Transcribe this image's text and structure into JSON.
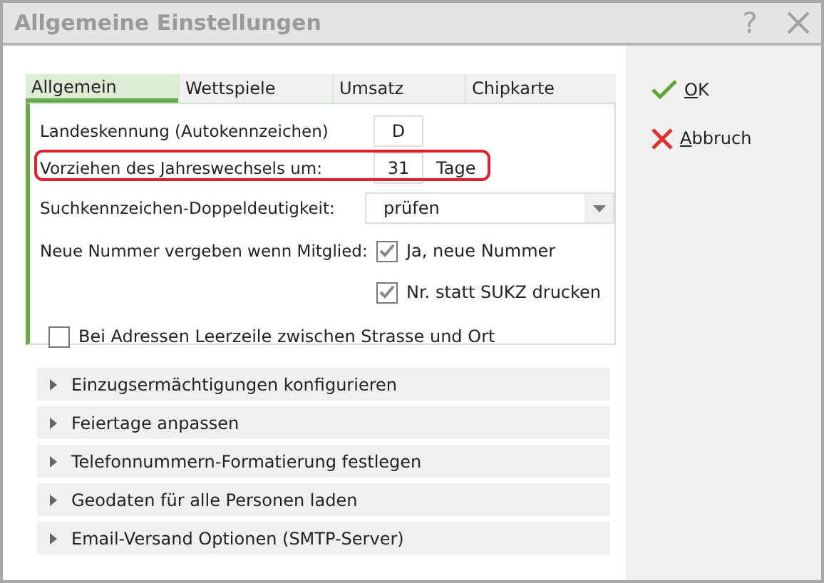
{
  "window": {
    "title": "Allgemeine Einstellungen",
    "help": "?"
  },
  "tabs": [
    {
      "label": "Allgemein",
      "selected": true
    },
    {
      "label": "Wettspiele",
      "selected": false
    },
    {
      "label": "Umsatz",
      "selected": false
    },
    {
      "label": "Chipkarte",
      "selected": false
    }
  ],
  "fields": [
    {
      "kind": "input",
      "label": "Landeskennung (Autokennzeichen)",
      "value": "D",
      "highlighted": false
    },
    {
      "kind": "input",
      "label": "Vorziehen des Jahreswechsels um:",
      "value": "31",
      "unit": "Tage",
      "highlighted": true
    },
    {
      "kind": "select",
      "label": "Suchkennzeichen-Doppeldeutigkeit:",
      "value": "prüfen",
      "highlighted": false
    },
    {
      "kind": "checks",
      "label": "Neue Nummer vergeben wenn Mitglied:",
      "options": [
        {
          "label": "Ja, neue Nummer",
          "checked": true
        },
        {
          "label": "Nr. statt SUKZ drucken",
          "checked": true
        }
      ],
      "highlighted": false
    }
  ],
  "address_check": {
    "label": "Bei Adressen Leerzeile zwischen Strasse und Ort",
    "checked": false
  },
  "sections": [
    {
      "label": "Einzugsermächtigungen konfigurieren",
      "expanded": false
    },
    {
      "label": "Feiertage anpassen",
      "expanded": false
    },
    {
      "label": "Telefonnummern-Formatierung festlegen",
      "expanded": false
    },
    {
      "label": "Geodaten für alle Personen laden",
      "expanded": false
    },
    {
      "label": "Email-Versand Optionen (SMTP-Server)",
      "expanded": false
    }
  ],
  "buttons": [
    {
      "kind": "ok",
      "label": "OK"
    },
    {
      "kind": "cancel",
      "label": "Abbruch"
    }
  ]
}
